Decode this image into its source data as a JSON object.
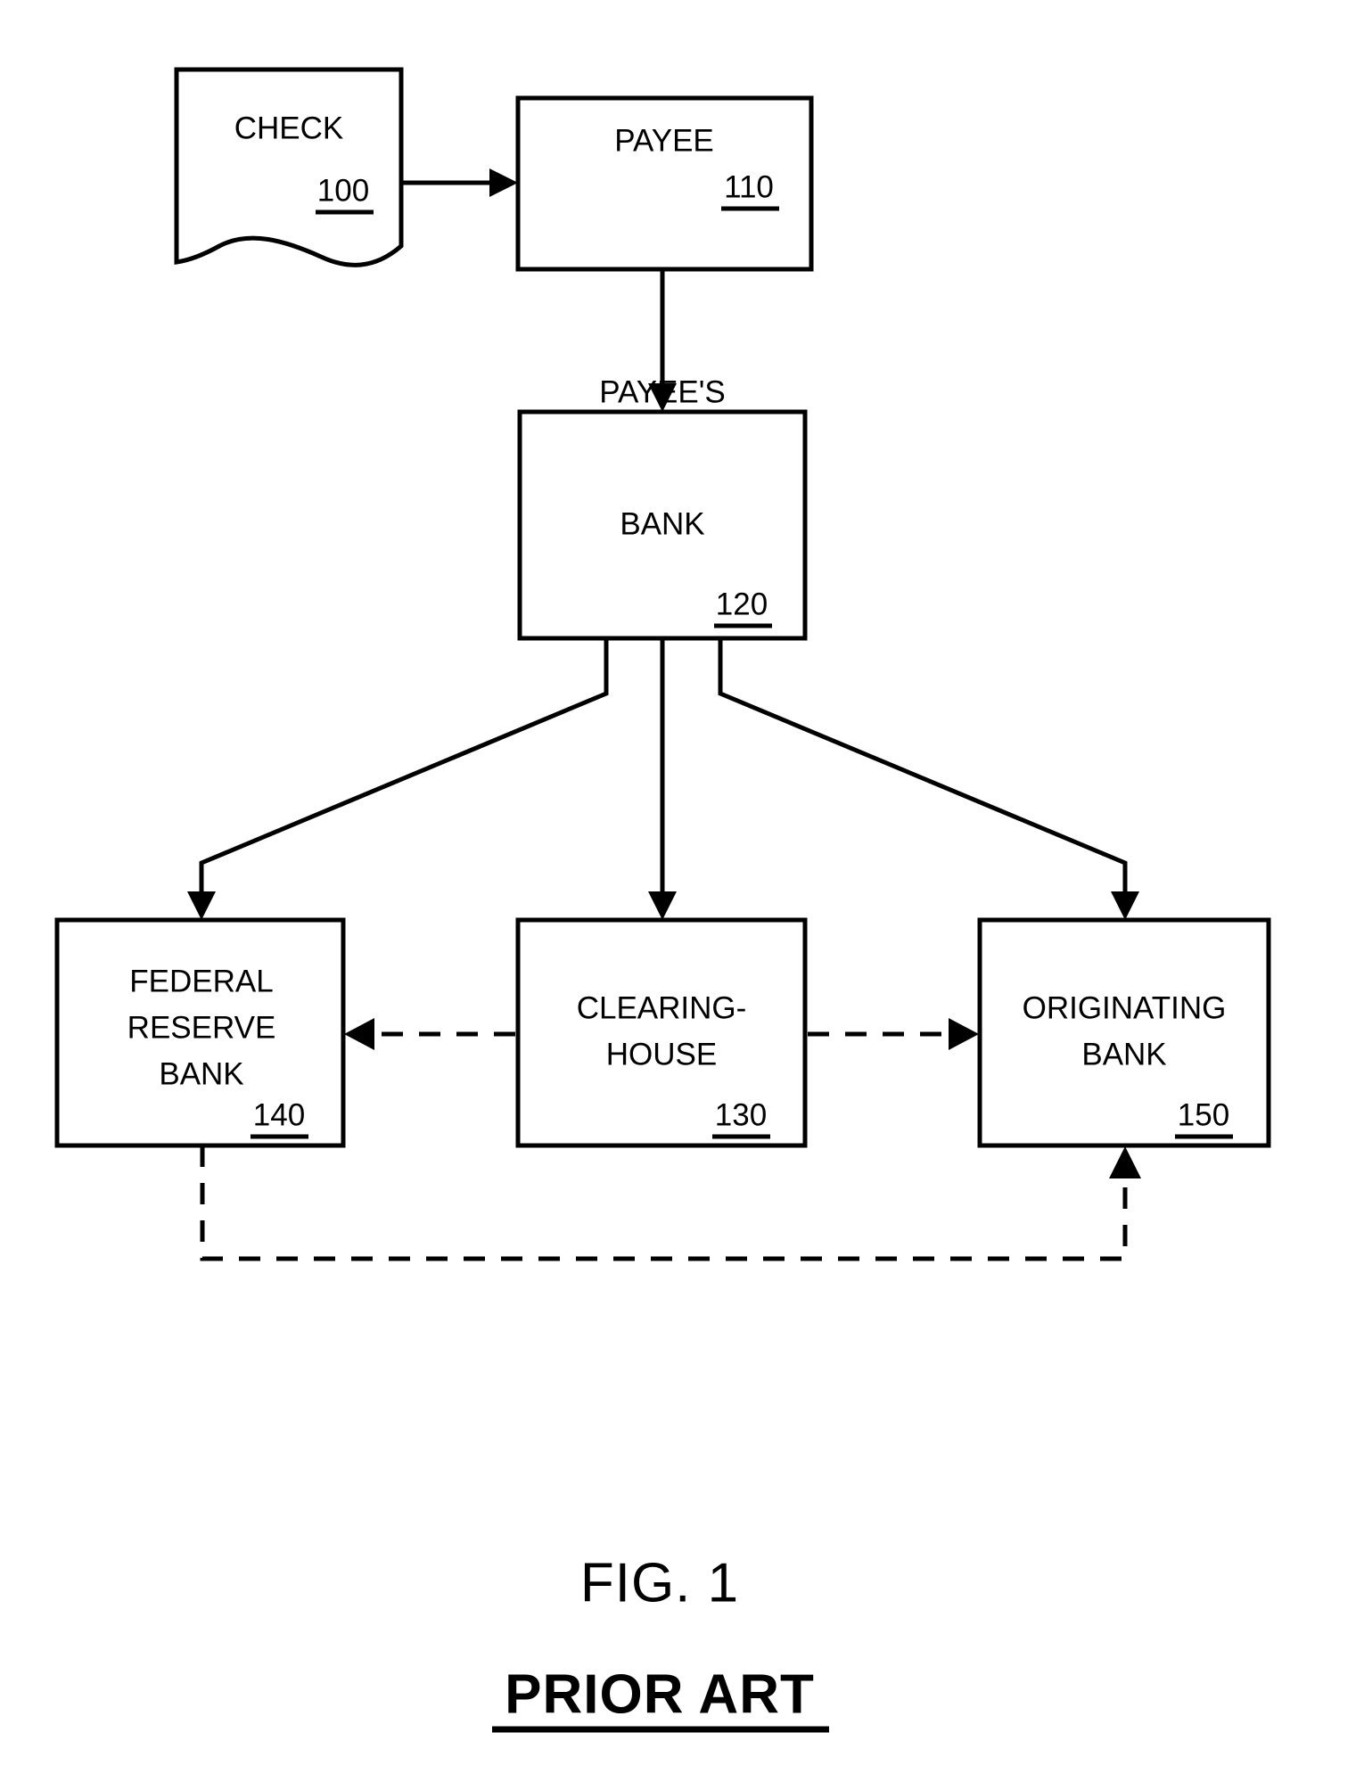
{
  "figure": {
    "title": "FIG. 1",
    "subtitle": "PRIOR ART"
  },
  "nodes": [
    {
      "id": "check",
      "shape": "document",
      "lines": [
        "CHECK"
      ],
      "ref": "100"
    },
    {
      "id": "payee",
      "shape": "rect",
      "lines": [
        "PAYEE"
      ],
      "ref": "110"
    },
    {
      "id": "payees-bank",
      "shape": "rect",
      "lines": [
        "PAYEE'S",
        "BANK"
      ],
      "ref": "120"
    },
    {
      "id": "federal-reserve-bank",
      "shape": "rect",
      "lines": [
        "FEDERAL",
        "RESERVE",
        "BANK"
      ],
      "ref": "140"
    },
    {
      "id": "clearinghouse",
      "shape": "rect",
      "lines": [
        "CLEARING-",
        "HOUSE"
      ],
      "ref": "130"
    },
    {
      "id": "originating-bank",
      "shape": "rect",
      "lines": [
        "ORIGINATING",
        "BANK"
      ],
      "ref": "150"
    }
  ],
  "connectors": [
    {
      "id": "check-to-payee",
      "style": "solid",
      "from": "check",
      "to": "payee"
    },
    {
      "id": "payee-to-payees-bank",
      "style": "solid",
      "from": "payee",
      "to": "payees-bank"
    },
    {
      "id": "payees-bank-to-federal-reserve-bank",
      "style": "solid",
      "from": "payees-bank",
      "to": "federal-reserve-bank"
    },
    {
      "id": "payees-bank-to-clearinghouse",
      "style": "solid",
      "from": "payees-bank",
      "to": "clearinghouse"
    },
    {
      "id": "payees-bank-to-originating-bank",
      "style": "solid",
      "from": "payees-bank",
      "to": "originating-bank"
    },
    {
      "id": "clearinghouse-to-federal-reserve-bank",
      "style": "dashed",
      "from": "clearinghouse",
      "to": "federal-reserve-bank"
    },
    {
      "id": "clearinghouse-to-originating-bank",
      "style": "dashed",
      "from": "clearinghouse",
      "to": "originating-bank"
    },
    {
      "id": "federal-reserve-bank-to-originating-bank",
      "style": "dashed",
      "from": "federal-reserve-bank",
      "to": "originating-bank"
    }
  ],
  "colors": {
    "background": "#ffffff",
    "stroke": "#000000",
    "text": "#000000"
  }
}
